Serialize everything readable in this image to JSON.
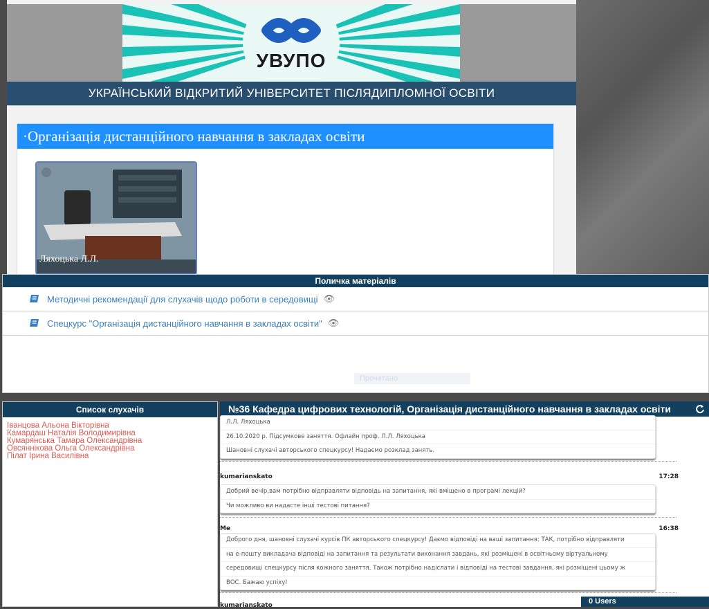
{
  "header": {
    "logo_text": "УВУПО",
    "university_name": "УКРАЇНСЬКИЙ ВІДКРИТИЙ УНІВЕРСИТЕТ ПІСЛЯДИПЛОМНОЇ ОСВІТИ"
  },
  "course": {
    "bullet": "·",
    "title": "Організація дистанційного навчання в закладах освіти",
    "photo_caption": "Ляхоцька Л.Л."
  },
  "shelf": {
    "title": "Поличка матеріалів",
    "items": [
      {
        "label": "Методичні рекомендації для слухачів щодо роботи в середовищі",
        "icon": "book-icon"
      },
      {
        "label": "Спецкурс \"Організація дистанційного навчання в закладах освіти\"",
        "icon": "book-icon"
      }
    ],
    "faint_button": "Прочитано"
  },
  "listeners": {
    "title": "Список слухачів",
    "items": [
      "Іванцова Альона Вікторівна",
      "Камардаш Наталія Володимирівна",
      "Кумарянська Тамара Олександрівна",
      "Овсяннікова Ольга Олександрівна",
      "Пілат Ірина Василівна"
    ]
  },
  "chat": {
    "title": "№36 Кафедра цифрових технологій, Організація дистанційного навчання в закладах освіти",
    "messages": [
      {
        "author": "",
        "time": "",
        "lines": [
          "Л.Л. Ляхоцька",
          "26.10.2020 р. Підсумкове заняття. Офлайн проф. Л.Л. Ляхоцька",
          "Шановні слухачі авторського спецкурсу! Надаємо розклад занять."
        ]
      },
      {
        "author": "kumarianskato",
        "time": "17:28",
        "lines": [
          "Добрий вечір,вам потрібно відправляти відповідь на запитання, які вміщено в програмі лекцій?",
          "Чи можливо ви надасте інші тестові питання?"
        ]
      },
      {
        "author": "Me",
        "time": "16:38",
        "lines": [
          "Доброго дня, шановні слухачі курсів ПК авторського спецкурсу! Даємо відповіді на ваші запитання: ТАК, потрібно відправляти",
          "на е-пошту викладача відповіді на запитання та результати виконання завдань, які розміщені в освітньому віртуальному",
          "середовищі спецкурсу після кожного заняття. Також потрібно надіслати і відповіді на тестові завдання, які розміщені цьому ж",
          "ВОС. Бажаю успіху!"
        ]
      },
      {
        "author": "kumarianskato",
        "time": "",
        "lines": []
      }
    ],
    "users_badge": "0 Users"
  },
  "colors": {
    "navy": "#13405f",
    "course_blue": "#1e90ff",
    "link_blue": "#3a7fc0",
    "listener_red": "#e05a50"
  }
}
